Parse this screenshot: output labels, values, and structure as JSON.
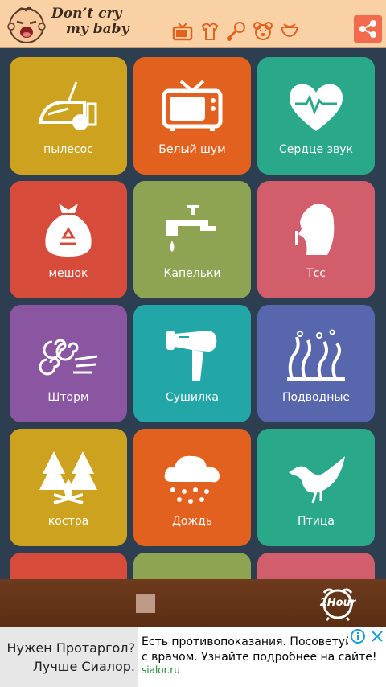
{
  "app": {
    "title_line1": "Don’t cry",
    "title_line2": "my baby"
  },
  "header": {
    "icons": [
      "tv-icon",
      "baby-clothes-icon",
      "rattle-icon",
      "teddy-bear-icon",
      "diaper-icon"
    ],
    "share_icon": "share-icon",
    "share_color": "#f26b4f"
  },
  "tiles": [
    {
      "label": "пылесос",
      "icon": "vacuum-cleaner-icon",
      "color": "#cda21f"
    },
    {
      "label": "Белый шум",
      "icon": "tv-icon",
      "color": "#e2611e"
    },
    {
      "label": "Сердце звук",
      "icon": "heartbeat-icon",
      "color": "#2aa98a"
    },
    {
      "label": "мешок",
      "icon": "recycle-bag-icon",
      "color": "#d74b3a"
    },
    {
      "label": "Капельки",
      "icon": "faucet-icon",
      "color": "#8fa453"
    },
    {
      "label": "Тсс",
      "icon": "shushing-woman-icon",
      "color": "#d25e6c"
    },
    {
      "label": "Шторм",
      "icon": "wind-icon",
      "color": "#8a55a1"
    },
    {
      "label": "Сушилка",
      "icon": "hair-dryer-icon",
      "color": "#23a6a7"
    },
    {
      "label": "Подводные",
      "icon": "seaweed-icon",
      "color": "#5866ad"
    },
    {
      "label": "костра",
      "icon": "campfire-icon",
      "color": "#cda21f"
    },
    {
      "label": "Дождь",
      "icon": "rain-cloud-icon",
      "color": "#e2611e"
    },
    {
      "label": "Птица",
      "icon": "bird-icon",
      "color": "#2aa98a"
    },
    {
      "label": "",
      "icon": "",
      "color": "#d74b3a"
    },
    {
      "label": "",
      "icon": "",
      "color": "#8fa453"
    },
    {
      "label": "",
      "icon": "",
      "color": "#d25e6c"
    }
  ],
  "bottom_bar": {
    "stop_icon": "stop-icon",
    "timer_label": "2Hour",
    "timer_icon": "alarm-clock-icon"
  },
  "ad": {
    "left_text_line1": "Нужен Протаргол?",
    "left_text_line2": "Лучше Сиалор.",
    "body": "Есть противопоказания. Посоветуйтесь с врачом. Узнайте подробнее на сайте!",
    "domain": "sialor.ru"
  }
}
